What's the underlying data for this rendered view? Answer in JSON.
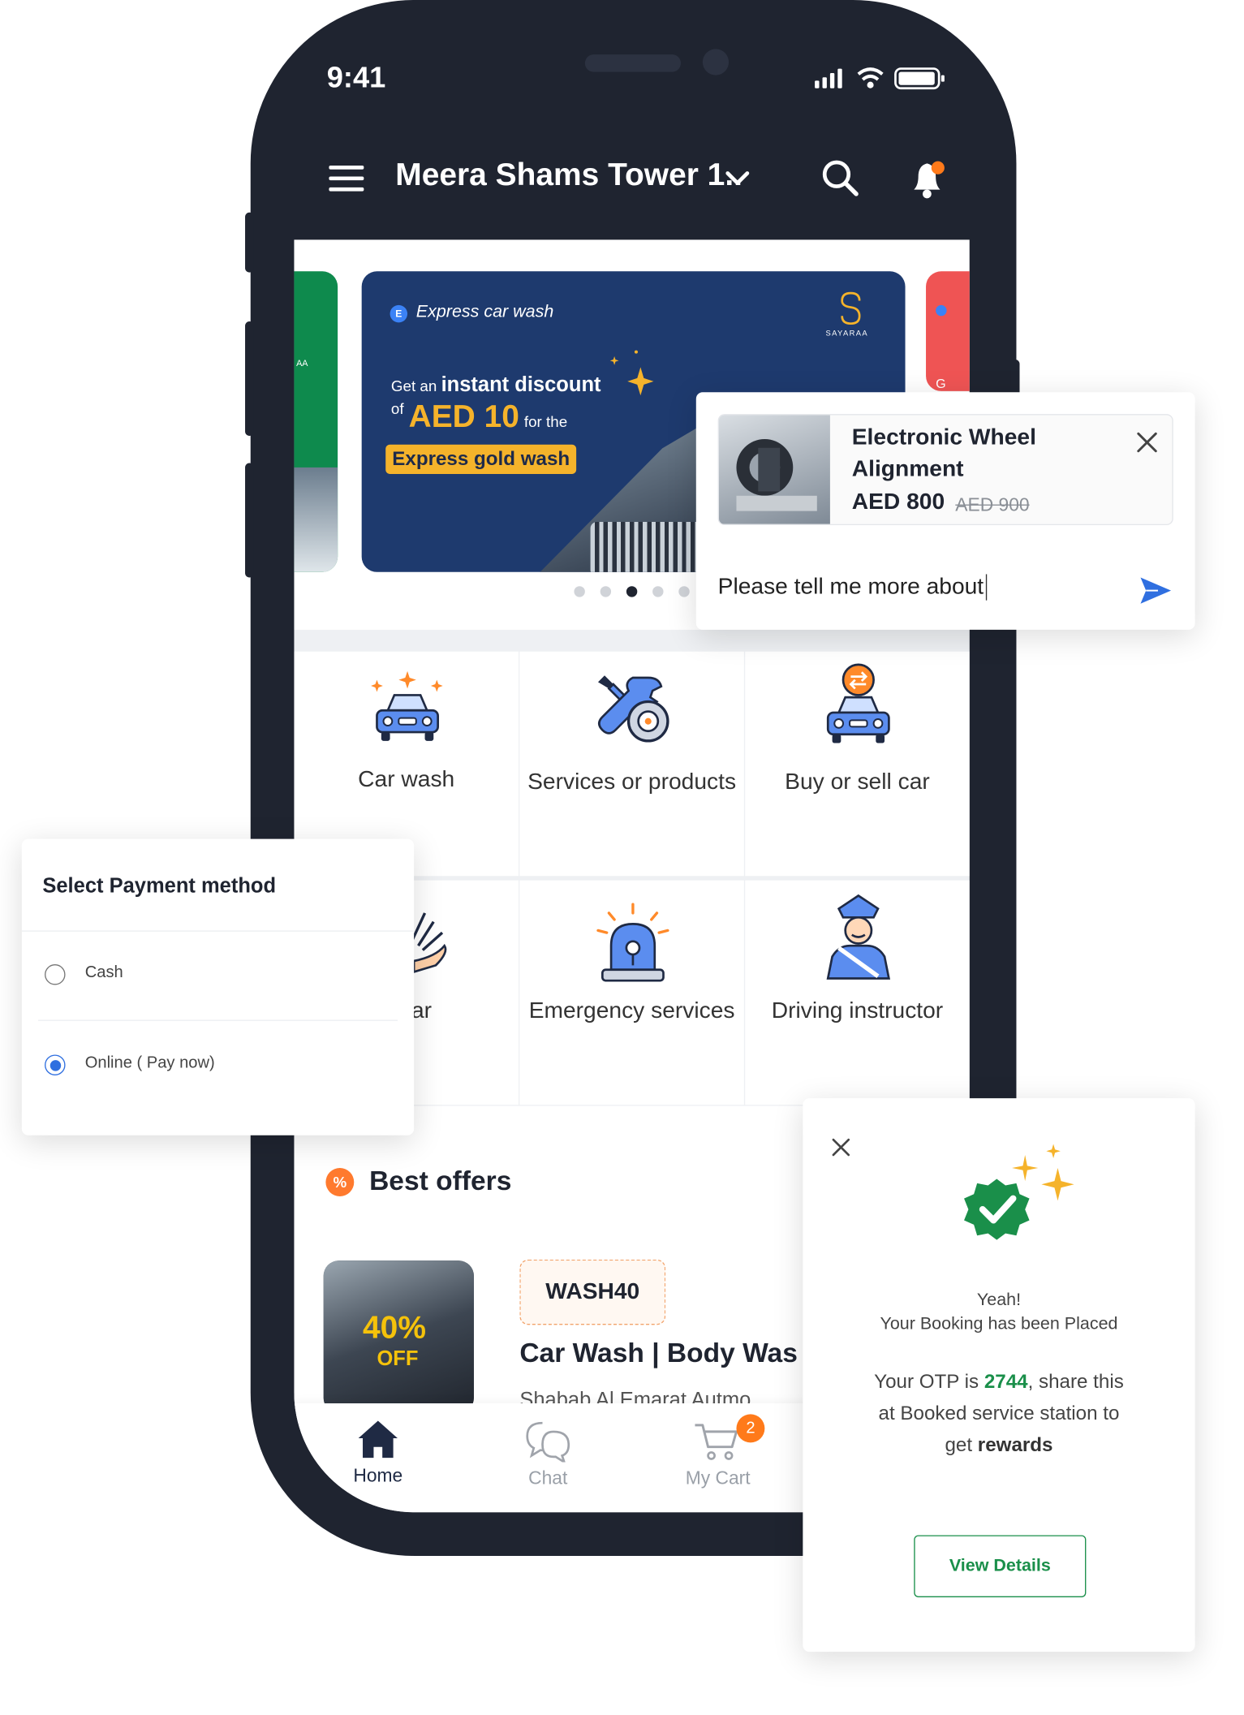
{
  "status": {
    "time": "9:41"
  },
  "header": {
    "location": "Meera Shams Tower 1..",
    "icons": [
      "menu-icon",
      "chevron-down-icon",
      "search-icon",
      "bell-icon"
    ]
  },
  "banner": {
    "label": "Express car wash",
    "label_badge": "E",
    "brand": "SAYARAA",
    "line1_prefix": "Get an",
    "line1_bold": "instant discount",
    "line2_prefix": "of",
    "amount": "AED 10",
    "line2_suffix": "for the",
    "pill": "Express gold wash",
    "dots": 5,
    "active_dot": 3,
    "side_left_text": "AA",
    "side_right_text": "G",
    "colors": {
      "banner": "#1e3a6e",
      "accent": "#f5b32b",
      "left": "#0e8a4d",
      "right": "#ef5454"
    }
  },
  "services": [
    {
      "label": "Car wash",
      "icon": "car-wash-icon"
    },
    {
      "label": "Services or products",
      "icon": "tools-icon"
    },
    {
      "label": "Buy or sell car",
      "icon": "buy-sell-car-icon"
    },
    {
      "label": "a car",
      "icon": "rent-car-icon"
    },
    {
      "label": "Emergency services",
      "icon": "siren-icon"
    },
    {
      "label": "Driving instructor",
      "icon": "instructor-icon"
    }
  ],
  "offers": {
    "title": "Best offers",
    "image_text_percent": "40%",
    "image_text_off": "OFF",
    "code": "WASH40",
    "name": "Car Wash | Body Was",
    "vendor": "Shabab Al Emarat Autmo"
  },
  "tabbar": {
    "home": "Home",
    "chat": "Chat",
    "cart": "My Cart",
    "cart_badge": "2"
  },
  "chat_card": {
    "product_title": "Electronic Wheel Alignment",
    "price": "AED 800",
    "old_price": "AED 900",
    "input_value": "Please tell me more about"
  },
  "payment": {
    "title": "Select Payment method",
    "options": [
      {
        "label": "Cash",
        "selected": false
      },
      {
        "label": "Online ( Pay now)",
        "selected": true
      }
    ]
  },
  "booking": {
    "line1": "Yeah!",
    "line2": "Your Booking has been Placed",
    "otp_prefix": "Your OTP is",
    "otp": "2744",
    "otp_suffix": ", share this",
    "line4": "at Booked service station to",
    "line5_prefix": "get",
    "line5_bold": "rewards",
    "button": "View Details",
    "colors": {
      "green": "#1a8f4a"
    }
  }
}
